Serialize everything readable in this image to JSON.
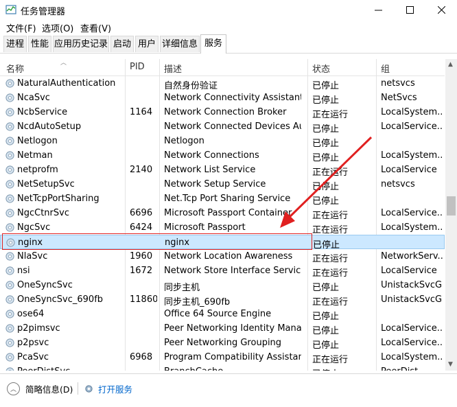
{
  "window": {
    "title": "任务管理器",
    "minimize": "—",
    "maximize": "☐",
    "close": "✕"
  },
  "menu": [
    "文件(F)",
    "选项(O)",
    "查看(V)"
  ],
  "tabs": [
    "进程",
    "性能",
    "应用历史记录",
    "启动",
    "用户",
    "详细信息",
    "服务"
  ],
  "active_tab": "服务",
  "columns": {
    "name": "名称",
    "pid": "PID",
    "desc": "描述",
    "status": "状态",
    "group": "组"
  },
  "rows": [
    {
      "name": "NaturalAuthentication",
      "pid": "",
      "desc": "自然身份验证",
      "status": "已停止",
      "group": "netsvcs"
    },
    {
      "name": "NcaSvc",
      "pid": "",
      "desc": "Network Connectivity Assistant",
      "status": "已停止",
      "group": "NetSvcs"
    },
    {
      "name": "NcbService",
      "pid": "1164",
      "desc": "Network Connection Broker",
      "status": "正在运行",
      "group": "LocalSystem..."
    },
    {
      "name": "NcdAutoSetup",
      "pid": "",
      "desc": "Network Connected Devices Aut...",
      "status": "已停止",
      "group": "LocalService..."
    },
    {
      "name": "Netlogon",
      "pid": "",
      "desc": "Netlogon",
      "status": "已停止",
      "group": ""
    },
    {
      "name": "Netman",
      "pid": "",
      "desc": "Network Connections",
      "status": "已停止",
      "group": "LocalSystem..."
    },
    {
      "name": "netprofm",
      "pid": "2140",
      "desc": "Network List Service",
      "status": "正在运行",
      "group": "LocalService"
    },
    {
      "name": "NetSetupSvc",
      "pid": "",
      "desc": "Network Setup Service",
      "status": "已停止",
      "group": "netsvcs"
    },
    {
      "name": "NetTcpPortSharing",
      "pid": "",
      "desc": "Net.Tcp Port Sharing Service",
      "status": "已停止",
      "group": ""
    },
    {
      "name": "NgcCtnrSvc",
      "pid": "6696",
      "desc": "Microsoft Passport Container",
      "status": "正在运行",
      "group": "LocalService..."
    },
    {
      "name": "NgcSvc",
      "pid": "6424",
      "desc": "Microsoft Passport",
      "status": "正在运行",
      "group": "LocalSystem..."
    },
    {
      "name": "nginx",
      "pid": "",
      "desc": "nginx",
      "status": "已停止",
      "group": "",
      "selected": true
    },
    {
      "name": "NlaSvc",
      "pid": "1960",
      "desc": "Network Location Awareness",
      "status": "正在运行",
      "group": "NetworkServ..."
    },
    {
      "name": "nsi",
      "pid": "1672",
      "desc": "Network Store Interface Service",
      "status": "正在运行",
      "group": "LocalService"
    },
    {
      "name": "OneSyncSvc",
      "pid": "",
      "desc": "同步主机",
      "status": "已停止",
      "group": "UnistackSvcG..."
    },
    {
      "name": "OneSyncSvc_690fb",
      "pid": "11860",
      "desc": "同步主机_690fb",
      "status": "正在运行",
      "group": "UnistackSvcG..."
    },
    {
      "name": "ose64",
      "pid": "",
      "desc": "Office 64 Source Engine",
      "status": "已停止",
      "group": ""
    },
    {
      "name": "p2pimsvc",
      "pid": "",
      "desc": "Peer Networking Identity Manager",
      "status": "已停止",
      "group": "LocalService..."
    },
    {
      "name": "p2psvc",
      "pid": "",
      "desc": "Peer Networking Grouping",
      "status": "已停止",
      "group": "LocalService..."
    },
    {
      "name": "PcaSvc",
      "pid": "6968",
      "desc": "Program Compatibility Assistant ...",
      "status": "正在运行",
      "group": "LocalSystem..."
    },
    {
      "name": "PeerDistSvc",
      "pid": "",
      "desc": "BranchCache",
      "status": "已停止",
      "group": "PeerDist"
    }
  ],
  "footer": {
    "fewer_details": "简略信息(D)",
    "open_services": "打开服务"
  },
  "colors": {
    "selection": "#cce8ff",
    "annotation": "#e02020",
    "link": "#0066cc"
  }
}
